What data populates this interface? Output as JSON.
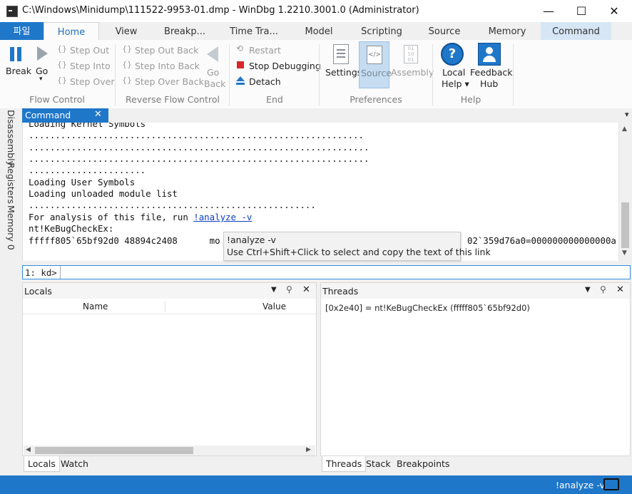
{
  "window": {
    "title": "C:\\Windows\\Minidump\\111522-9953-01.dmp - WinDbg 1.2210.3001.0 (Administrator)",
    "minimize": "—",
    "maximize": "☐",
    "close": "✕"
  },
  "ribbon_tabs": [
    "파일",
    "Home",
    "View",
    "Breakp...",
    "Time Tra...",
    "Model",
    "Scripting",
    "Source",
    "Memory",
    "Command"
  ],
  "ribbon": {
    "flow_control": {
      "label": "Flow Control",
      "break": "Break",
      "go": "Go",
      "step_out": "Step Out",
      "step_into": "Step Into",
      "step_over": "Step Over"
    },
    "reverse_flow": {
      "label": "Reverse Flow Control",
      "step_out_back": "Step Out Back",
      "step_into_back": "Step Into Back",
      "step_over_back": "Step Over Back",
      "go_back_1": "Go",
      "go_back_2": "Back"
    },
    "end": {
      "label": "End",
      "restart": "Restart",
      "stop_debugging": "Stop Debugging",
      "detach": "Detach"
    },
    "preferences": {
      "label": "Preferences",
      "settings": "Settings",
      "source": "Source",
      "assembly": "Assembly"
    },
    "help": {
      "label": "Help",
      "local_help_1": "Local",
      "local_help_2": "Help ▾",
      "feedback_1": "Feedback",
      "feedback_2": "Hub"
    }
  },
  "side_tabs": [
    "Disassembly",
    "Registers",
    "Memory 0"
  ],
  "command": {
    "tab_label": "Command",
    "lines": [
      "Loading Kernel Symbols",
      "...............................................................",
      "................................................................",
      "................................................................",
      "......................",
      "Loading User Symbols",
      "Loading unloaded module list",
      "......................................................"
    ],
    "analysis_prefix": "For analysis of this file, run ",
    "analysis_link": "!analyze -v",
    "bugcheck_label": "nt!KeBugCheckEx:",
    "bugcheck_left": "fffff805`65bf92d0 48894c2408      mo",
    "bugcheck_right": "02`359d76a0=000000000000000a",
    "tooltip_line1": "!analyze -v",
    "tooltip_line2": "Use Ctrl+Shift+Click to select and copy the text of this link",
    "prompt": "1: kd>"
  },
  "locals": {
    "title": "Locals",
    "col_name": "Name",
    "col_value": "Value",
    "tabs": [
      "Locals",
      "Watch"
    ]
  },
  "threads": {
    "title": "Threads",
    "entry": "[0x2e40] = nt!KeBugCheckEx (fffff805`65bf92d0)",
    "tabs": [
      "Threads",
      "Stack",
      "Breakpoints"
    ]
  },
  "status": {
    "text": "!analyze -v"
  },
  "colors": {
    "accent": "#1f77c9",
    "stop_red": "#d9262c",
    "link_blue": "#0b3fc0"
  }
}
